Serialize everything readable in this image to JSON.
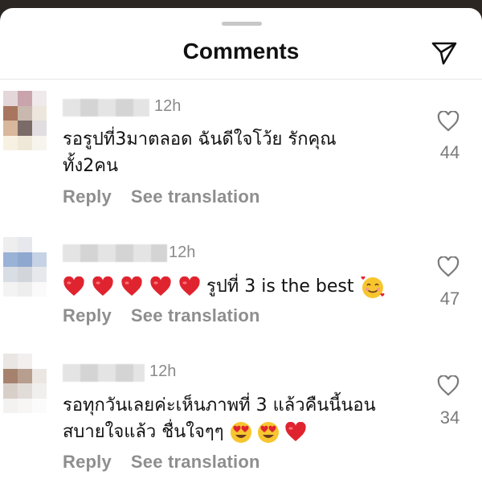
{
  "header": {
    "title": "Comments",
    "share_icon": "paper-plane-icon"
  },
  "comments": [
    {
      "time": "12h",
      "text": "รอรูปที่3มาตลอด ฉันดีใจโว้ย รักคุณทั้ง2คน",
      "reply_label": "Reply",
      "translate_label": "See translation",
      "like_count": "44",
      "avatar_colors": [
        "#e3d7da",
        "#c9a4ad",
        "#efe9eb",
        "#a8765e",
        "#c9b8ae",
        "#ece6dd",
        "#d8b79c",
        "#7a6b68",
        "#e2dde0",
        "#f6f1e3",
        "#efe8d8",
        "#f7f4ee"
      ]
    },
    {
      "time": "12h",
      "text_suffix": "รูปที่ 3 is the best",
      "emojis_before": [
        "heart",
        "heart",
        "heart",
        "heart",
        "heart"
      ],
      "emoji_after": "smiling-face-with-hearts",
      "reply_label": "Reply",
      "translate_label": "See translation",
      "like_count": "47",
      "avatar_colors": [
        "#eeeeee",
        "#e6e8ee",
        "#ffffff",
        "#9ab2d6",
        "#8fa8cf",
        "#c6d2e5",
        "#d9dde4",
        "#d2d6db",
        "#e6e8eb",
        "#f3f3f3",
        "#eeeeee",
        "#fafafa"
      ]
    },
    {
      "time": "12h",
      "text": "รอทุกวันเลยค่ะเห็นภาพที่ 3 แล้วคืนนี้นอนสบายใจแล้ว ชื่นใจๆๆ",
      "emojis_after": [
        "heart-eyes",
        "heart-eyes",
        "heart"
      ],
      "reply_label": "Reply",
      "translate_label": "See translation",
      "like_count": "34",
      "avatar_colors": [
        "#e9e6e3",
        "#f2efee",
        "#ffffff",
        "#a6826e",
        "#b89e8f",
        "#ece6e2",
        "#d9cfc9",
        "#e2dcd8",
        "#f1efed",
        "#f4f2f0",
        "#f7f6f5",
        "#fbfbfb"
      ]
    }
  ],
  "colors": {
    "heart_red": "#e0242f",
    "muted": "#8e8e8e",
    "emoji_yellow": "#f7c62f"
  }
}
